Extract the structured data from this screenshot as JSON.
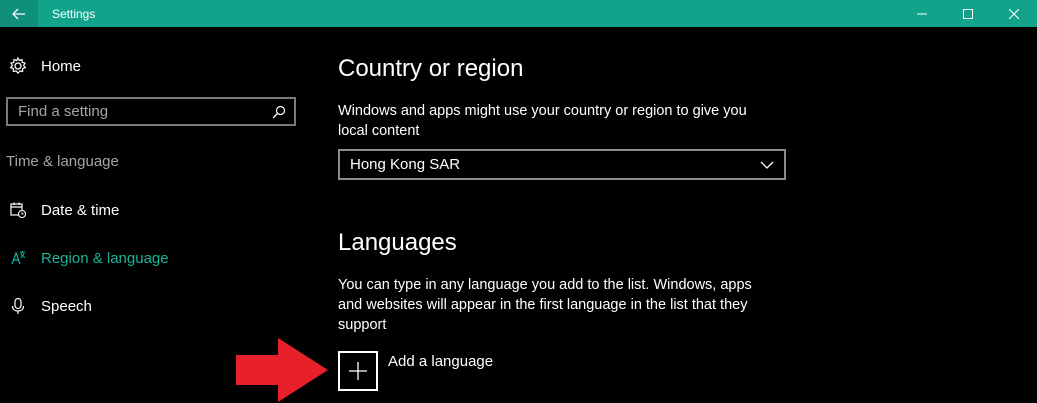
{
  "titlebar": {
    "title": "Settings"
  },
  "sidebar": {
    "home_label": "Home",
    "search_placeholder": "Find a setting",
    "section_label": "Time & language",
    "items": [
      {
        "label": "Date & time",
        "icon": "calendar-clock-icon",
        "selected": false
      },
      {
        "label": "Region & language",
        "icon": "region-language-icon",
        "selected": true
      },
      {
        "label": "Speech",
        "icon": "microphone-icon",
        "selected": false
      }
    ]
  },
  "main": {
    "country": {
      "heading": "Country or region",
      "description": "Windows and apps might use your country or region to give you local content",
      "selected_value": "Hong Kong SAR"
    },
    "languages": {
      "heading": "Languages",
      "description": "You can type in any language you add to the list. Windows, apps and websites will appear in the first language in the list that they support",
      "add_label": "Add a language"
    }
  },
  "colors": {
    "accent": "#12a38b",
    "selected_nav": "#16b59a",
    "arrow": "#e8202a"
  }
}
